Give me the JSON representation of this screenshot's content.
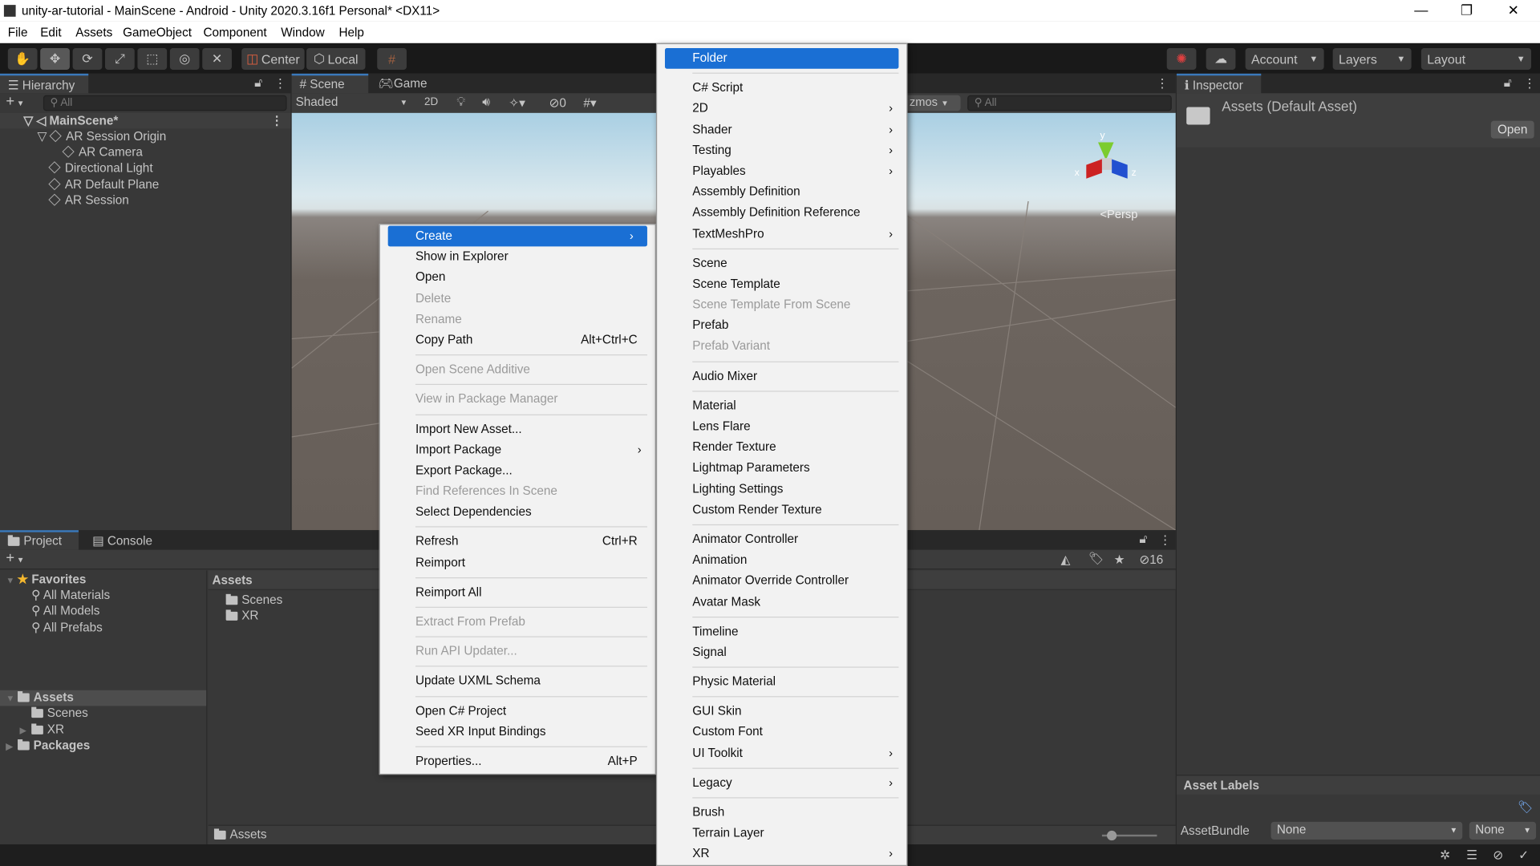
{
  "window": {
    "title": "unity-ar-tutorial - MainScene - Android - Unity 2020.3.16f1 Personal* <DX11>",
    "minimize": "—",
    "restore": "❐",
    "close": "✕"
  },
  "menubar": [
    "File",
    "Edit",
    "Assets",
    "GameObject",
    "Component",
    "Window",
    "Help"
  ],
  "toolbar": {
    "pivot": "Center",
    "space": "Local",
    "account": "Account",
    "layers": "Layers",
    "layout": "Layout"
  },
  "hierarchy": {
    "tab": "Hierarchy",
    "search_placeholder": "All",
    "items": [
      {
        "label": "MainScene*",
        "depth": 0,
        "bold": true,
        "expanded": true
      },
      {
        "label": "AR Session Origin",
        "depth": 1,
        "expanded": true
      },
      {
        "label": "AR Camera",
        "depth": 2
      },
      {
        "label": "Directional Light",
        "depth": 1
      },
      {
        "label": "AR Default Plane",
        "depth": 1
      },
      {
        "label": "AR Session",
        "depth": 1
      }
    ]
  },
  "scene": {
    "tabs": [
      "Scene",
      "Game"
    ],
    "shading": "Shaded",
    "mode2d": "2D",
    "hidden_count": "0",
    "gizmos": "zmos",
    "search_placeholder": "All",
    "persp": "Persp",
    "axes": {
      "x": "x",
      "y": "y",
      "z": "z"
    }
  },
  "context_menu": [
    {
      "label": "Create",
      "submenu": true,
      "highlighted": true
    },
    {
      "label": "Show in Explorer"
    },
    {
      "label": "Open"
    },
    {
      "label": "Delete",
      "disabled": true
    },
    {
      "label": "Rename",
      "disabled": true
    },
    {
      "label": "Copy Path",
      "shortcut": "Alt+Ctrl+C"
    },
    {
      "separator": true
    },
    {
      "label": "Open Scene Additive",
      "disabled": true
    },
    {
      "separator": true
    },
    {
      "label": "View in Package Manager",
      "disabled": true
    },
    {
      "separator": true
    },
    {
      "label": "Import New Asset..."
    },
    {
      "label": "Import Package",
      "submenu": true
    },
    {
      "label": "Export Package..."
    },
    {
      "label": "Find References In Scene",
      "disabled": true
    },
    {
      "label": "Select Dependencies"
    },
    {
      "separator": true
    },
    {
      "label": "Refresh",
      "shortcut": "Ctrl+R"
    },
    {
      "label": "Reimport"
    },
    {
      "separator": true
    },
    {
      "label": "Reimport All"
    },
    {
      "separator": true
    },
    {
      "label": "Extract From Prefab",
      "disabled": true
    },
    {
      "separator": true
    },
    {
      "label": "Run API Updater...",
      "disabled": true
    },
    {
      "separator": true
    },
    {
      "label": "Update UXML Schema"
    },
    {
      "separator": true
    },
    {
      "label": "Open C# Project"
    },
    {
      "label": "Seed XR Input Bindings"
    },
    {
      "separator": true
    },
    {
      "label": "Properties...",
      "shortcut": "Alt+P"
    }
  ],
  "create_submenu": [
    {
      "label": "Folder",
      "highlighted": true
    },
    {
      "separator": true
    },
    {
      "label": "C# Script"
    },
    {
      "label": "2D",
      "submenu": true
    },
    {
      "label": "Shader",
      "submenu": true
    },
    {
      "label": "Testing",
      "submenu": true
    },
    {
      "label": "Playables",
      "submenu": true
    },
    {
      "label": "Assembly Definition"
    },
    {
      "label": "Assembly Definition Reference"
    },
    {
      "label": "TextMeshPro",
      "submenu": true
    },
    {
      "separator": true
    },
    {
      "label": "Scene"
    },
    {
      "label": "Scene Template"
    },
    {
      "label": "Scene Template From Scene",
      "disabled": true
    },
    {
      "label": "Prefab"
    },
    {
      "label": "Prefab Variant",
      "disabled": true
    },
    {
      "separator": true
    },
    {
      "label": "Audio Mixer"
    },
    {
      "separator": true
    },
    {
      "label": "Material"
    },
    {
      "label": "Lens Flare"
    },
    {
      "label": "Render Texture"
    },
    {
      "label": "Lightmap Parameters"
    },
    {
      "label": "Lighting Settings"
    },
    {
      "label": "Custom Render Texture"
    },
    {
      "separator": true
    },
    {
      "label": "Animator Controller"
    },
    {
      "label": "Animation"
    },
    {
      "label": "Animator Override Controller"
    },
    {
      "label": "Avatar Mask"
    },
    {
      "separator": true
    },
    {
      "label": "Timeline"
    },
    {
      "label": "Signal"
    },
    {
      "separator": true
    },
    {
      "label": "Physic Material"
    },
    {
      "separator": true
    },
    {
      "label": "GUI Skin"
    },
    {
      "label": "Custom Font"
    },
    {
      "label": "UI Toolkit",
      "submenu": true
    },
    {
      "separator": true
    },
    {
      "label": "Legacy",
      "submenu": true
    },
    {
      "separator": true
    },
    {
      "label": "Brush"
    },
    {
      "label": "Terrain Layer"
    },
    {
      "label": "XR",
      "submenu": true
    }
  ],
  "project": {
    "tabs": [
      "Project",
      "Console"
    ],
    "favorites": "Favorites",
    "favorite_items": [
      "All Materials",
      "All Models",
      "All Prefabs"
    ],
    "tree": [
      {
        "label": "Assets",
        "depth": 0,
        "bold": true,
        "selected": true
      },
      {
        "label": "Scenes",
        "depth": 1
      },
      {
        "label": "XR",
        "depth": 1,
        "has_children": true
      },
      {
        "label": "Packages",
        "depth": 0,
        "bold": true,
        "has_children": true
      }
    ],
    "breadcrumb": "Assets",
    "contents": [
      "Scenes",
      "XR"
    ],
    "path": "Assets",
    "hidden_count": "16",
    "zoom_slider": 0.1
  },
  "inspector": {
    "tab": "Inspector",
    "title": "Assets (Default Asset)",
    "open_button": "Open",
    "asset_labels": "Asset Labels",
    "assetbundle_label": "AssetBundle",
    "assetbundle": "None",
    "variant": "None"
  },
  "colors": {
    "accent": "#1a6fd4",
    "panel": "#383838",
    "menu": "#f2f2f2"
  }
}
